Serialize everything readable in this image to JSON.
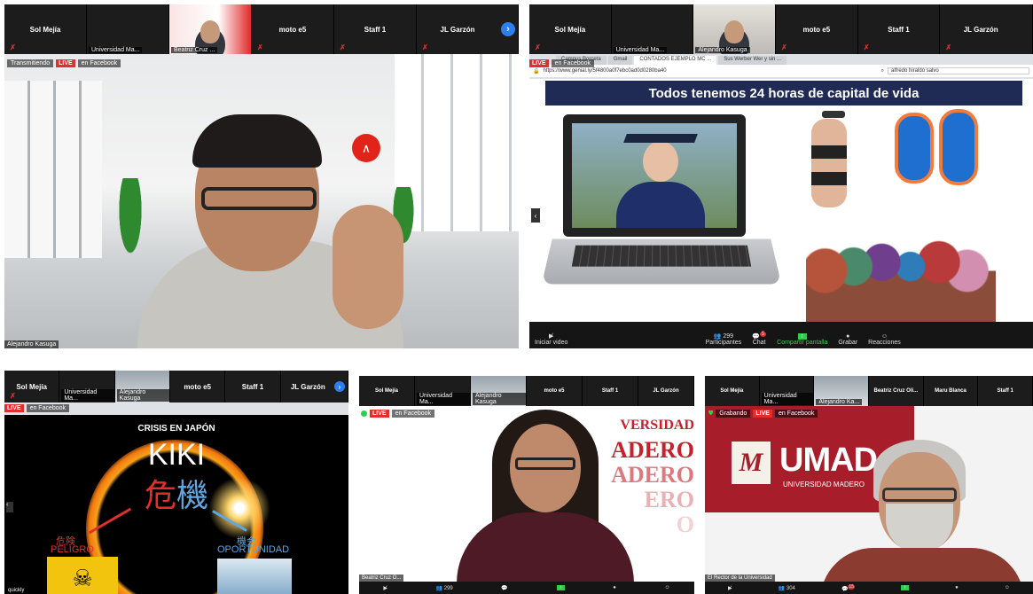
{
  "s1": {
    "tiles": [
      "Sol Mejía",
      "Universidad Ma...",
      "Beatriz Cruz ...",
      "moto e5",
      "Staff 1",
      "JL Garzón"
    ],
    "live": "LIVE",
    "fb": "en Facebook",
    "badge": "Transmitiendo",
    "speaker": "Alejandro Kasuga",
    "next": "›"
  },
  "s2": {
    "tiles": [
      "Sol Mejía",
      "Universidad Ma...",
      "Alejandro Kasuga",
      "moto e5",
      "Staff 1",
      "JL Garzón"
    ],
    "live": "LIVE",
    "fb": "en Facebook",
    "slide_title": "Todos tenemos 24 horas de capital de vida",
    "url": "https://www.genial.ly/5f4800a0f7ebc0ad0d0280ba40",
    "search": "alfredo hiraldo salvo",
    "tabs": [
      "Campus Borceta",
      "Gmail",
      "CONTADOS EJEMPLO MC ...",
      "Sus Werber Wer y sin ..."
    ],
    "controls": {
      "video": "Iniciar video",
      "participants": "Participantes",
      "count": "299",
      "chat": "Chat",
      "chat_badge": "5",
      "share": "Compartir pantalla",
      "record": "Grabar",
      "reactions": "Reacciones"
    }
  },
  "s3": {
    "tiles": [
      "Sol Mejía",
      "Universidad Ma...",
      "Alejandro Kasuga",
      "moto e5",
      "Staff 1",
      "JL Garzón"
    ],
    "live": "LIVE",
    "fb": "en Facebook",
    "title": "CRISIS EN JAPÓN",
    "kiki": "KIKI",
    "kanji1": "危",
    "kanji2": "機",
    "left_kanji": "危険",
    "left": "PELIGRO",
    "right_kanji": "機会",
    "right": "OPORTUNIDAD",
    "footer": "quickly"
  },
  "s4": {
    "tiles": [
      "Sol Mejía",
      "Universidad Ma...",
      "Alejandro Kasuga",
      "moto e5",
      "Staff 1",
      "JL Garzón"
    ],
    "live": "LIVE",
    "fb": "en Facebook",
    "banner": [
      "VERSIDAD",
      "ADERO",
      "ADERO",
      "ERO",
      "O"
    ],
    "speaker": "Beatriz Cruz O...",
    "count": "299"
  },
  "s5": {
    "tiles": [
      "Sol Mejía",
      "Universidad Ma...",
      "Alejandro Ka...",
      "Beatriz Cruz Oli...",
      "Maru Blanca",
      "Staff 1"
    ],
    "live": "LIVE",
    "fb": "en Facebook",
    "badge": "Grabando",
    "logo": "UMAD",
    "logo_sub": "UNIVERSIDAD MADERO",
    "speaker": "El Rector de la Universidad",
    "count": "304",
    "chat_badge": "15"
  }
}
